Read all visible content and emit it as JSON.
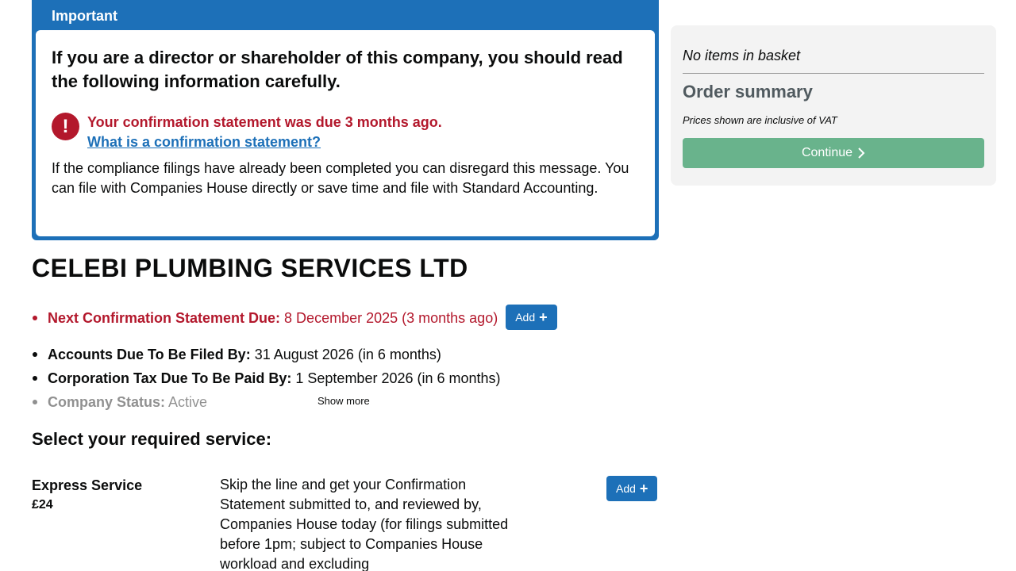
{
  "banner": {
    "header": "Important",
    "heading": "If you are a director or shareholder of this company, you should read the following information carefully.",
    "warning_icon": "!",
    "warning_text": "Your confirmation statement was due 3 months ago.",
    "warning_link": "What is a confirmation statement?",
    "paragraph": "If the compliance filings have already been completed you can disregard this message. You can file with Companies House directly or save time and file with Standard Accounting."
  },
  "company": {
    "name": "CELEBI PLUMBING SERVICES LTD"
  },
  "details": {
    "confirmation": {
      "label": "Next Confirmation Statement Due:",
      "value": "8 December 2025 (3 months ago)",
      "button": "Add"
    },
    "accounts": {
      "label": "Accounts Due To Be Filed By:",
      "value": "31 August 2026 (in 6 months)"
    },
    "corp_tax": {
      "label": "Corporation Tax Due To Be Paid By:",
      "value": "1 September 2026 (in 6 months)"
    },
    "status": {
      "label": "Company Status:",
      "value": "Active"
    },
    "show_more": "Show more"
  },
  "services": {
    "heading": "Select your required service:",
    "items": [
      {
        "name": "Express Service",
        "price": "£24",
        "description": "Skip the line and get your Confirmation Statement submitted to, and reviewed by, Companies House today (for filings submitted before 1pm; subject to Companies House workload and excluding",
        "button": "Add"
      }
    ]
  },
  "summary": {
    "basket_empty": "No items in basket",
    "title": "Order summary",
    "vat_note": "Prices shown are inclusive of VAT",
    "continue_label": "Continue"
  },
  "colors": {
    "brand_blue": "#1d70b8",
    "error_red": "#b3182c",
    "continue_green": "#69b38c",
    "summary_bg": "#f3f3f3"
  }
}
